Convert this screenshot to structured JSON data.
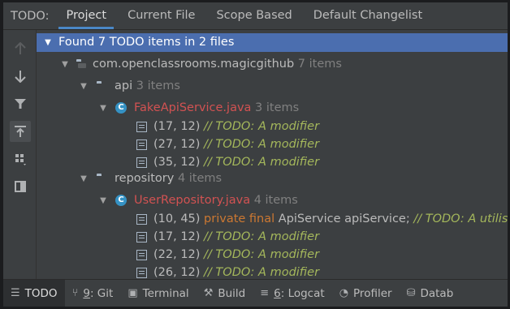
{
  "tabbar": {
    "tool_title": "TODO:",
    "tabs": [
      "Project",
      "Current File",
      "Scope Based",
      "Default Changelist"
    ]
  },
  "toolbar": {
    "buttons": [
      "arrow-up-icon",
      "arrow-down-icon",
      "filter-icon",
      "autoscroll-icon",
      "group-icon",
      "preview-icon"
    ]
  },
  "tree": {
    "root": "Found 7 TODO items in 2 files",
    "package": {
      "name": "com.openclassrooms.magicgithub",
      "count": "7 items"
    },
    "api": {
      "name": "api",
      "count": "3 items",
      "file": {
        "name": "FakeApiService.java",
        "count": "3 items"
      },
      "items": [
        {
          "pos": "(17, 12)",
          "comment": "// TODO: A modifier"
        },
        {
          "pos": "(27, 12)",
          "comment": "// TODO: A modifier"
        },
        {
          "pos": "(35, 12)",
          "comment": "// TODO: A modifier"
        }
      ]
    },
    "repository": {
      "name": "repository",
      "count": "4 items",
      "file": {
        "name": "UserRepository.java",
        "count": "4 items"
      },
      "first": {
        "pos": "(10, 45)",
        "keyword": "private final",
        "code": "ApiService apiService;",
        "comment": "// TODO: A utiliser"
      },
      "items": [
        {
          "pos": "(17, 12)",
          "comment": "// TODO: A modifier"
        },
        {
          "pos": "(22, 12)",
          "comment": "// TODO: A modifier"
        },
        {
          "pos": "(26, 12)",
          "comment": "// TODO: A modifier"
        }
      ]
    }
  },
  "bottombar": {
    "todo": "TODO",
    "git_num": "9",
    "git": ": Git",
    "terminal": "Terminal",
    "build": "Build",
    "logcat_num": "6",
    "logcat": ": Logcat",
    "profiler": "Profiler",
    "database": "Datab"
  },
  "colors": {
    "accent": "#4a88c7",
    "selection": "#4b6eaf",
    "filename": "#d25252",
    "comment": "#a4b75b",
    "keyword": "#cc7832"
  }
}
